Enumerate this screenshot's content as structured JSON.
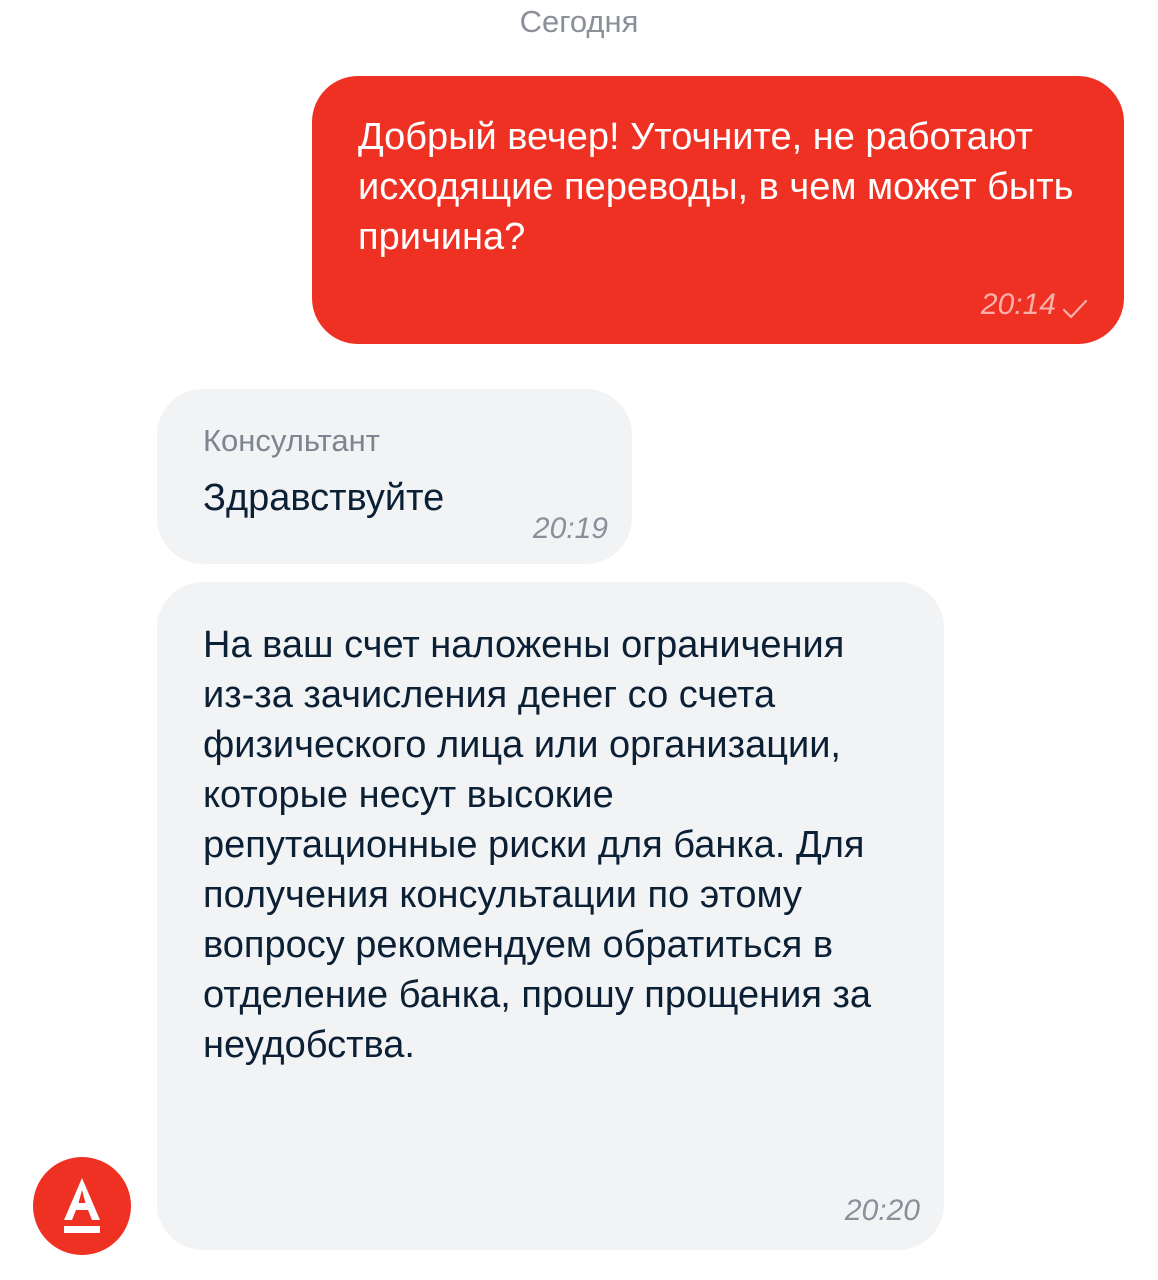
{
  "date_separator": "Сегодня",
  "messages": [
    {
      "direction": "outgoing",
      "text": "Добрый вечер! Уточните, не работают исходящие переводы, в чем может быть причина?",
      "time": "20:14",
      "status_icon": "check-icon"
    },
    {
      "direction": "incoming",
      "sender": "Консультант",
      "text": "Здравствуйте",
      "time": "20:19"
    },
    {
      "direction": "incoming",
      "text": "На ваш счет наложены ограничения из-за зачисления денег со счета физического лица или организации, которые несут высокие репутационные риски для банка. Для получения консультации по этому вопросу рекомендуем обратиться в отделение банка, прошу прощения за неудобства.",
      "time": "20:20"
    }
  ],
  "avatar": {
    "letter": "А",
    "icon": "bank-logo-icon"
  },
  "colors": {
    "accent": "#EF3124",
    "incoming_bubble": "#F2F3F5",
    "text_dark": "#0B1F35",
    "text_muted": "#8A8F99",
    "background": "#FFFFFF"
  }
}
